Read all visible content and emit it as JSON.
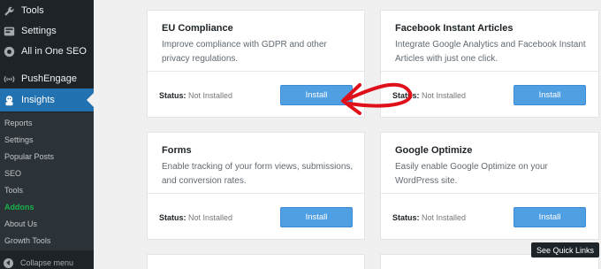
{
  "sidebar": {
    "menu": [
      {
        "label": "Tools",
        "icon": "wrench-icon"
      },
      {
        "label": "Settings",
        "icon": "settings-icon"
      },
      {
        "label": "All in One SEO",
        "icon": "aioseo-icon"
      },
      {
        "label": "PushEngage",
        "icon": "pushengage-icon"
      },
      {
        "label": "Insights",
        "icon": "insights-icon"
      }
    ],
    "submenu": [
      "Reports",
      "Settings",
      "Popular Posts",
      "SEO",
      "Tools",
      "Addons",
      "About Us",
      "Growth Tools"
    ],
    "collapse_label": "Collapse menu"
  },
  "cards": [
    {
      "title": "EU Compliance",
      "desc": "Improve compliance with GDPR and other privacy regulations.",
      "status_label": "Status:",
      "status_value": "Not Installed",
      "button": "Install"
    },
    {
      "title": "Facebook Instant Articles",
      "desc": "Integrate Google Analytics and Facebook Instant Articles with just one click.",
      "status_label": "Status:",
      "status_value": "Not Installed",
      "button": "Install"
    },
    {
      "title": "Forms",
      "desc": "Enable tracking of your form views, submissions, and conversion rates.",
      "status_label": "Status:",
      "status_value": "Not Installed",
      "button": "Install"
    },
    {
      "title": "Google Optimize",
      "desc": "Easily enable Google Optimize on your WordPress site.",
      "status_label": "Status:",
      "status_value": "Not Installed",
      "button": "Install"
    }
  ],
  "tooltip": "See Quick Links",
  "colors": {
    "sidebar": "#1d2327",
    "active": "#2271b1",
    "button": "#509fe2",
    "addons": "#18b14a",
    "annotation": "#e0101a"
  }
}
